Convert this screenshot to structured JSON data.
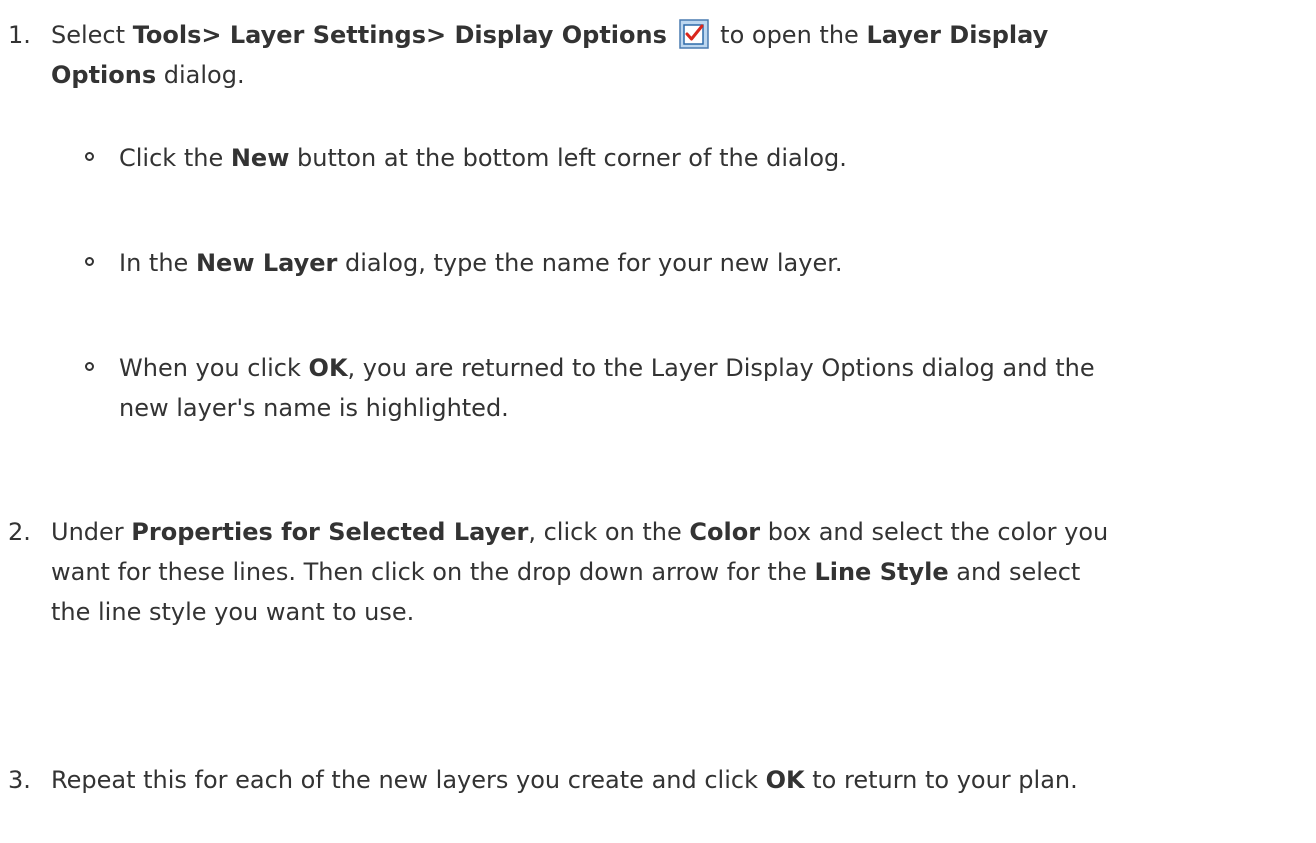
{
  "step1": {
    "number": "1.",
    "select": "Select",
    "menu_path": "Tools> Layer Settings> Display Options",
    "icon": "display-options-checkbox-icon",
    "mid": "to open the",
    "dialog_a": "Layer Display",
    "dialog_b": "Options",
    "end": "dialog."
  },
  "sub1": {
    "pre": "Click the",
    "button": "New",
    "post": "button at the bottom left corner of the dialog."
  },
  "sub2": {
    "pre": "In the",
    "dialog": "New Layer",
    "post": "dialog, type the name for your new layer."
  },
  "sub3": {
    "pre": "When you click",
    "button": "OK",
    "post": ", you are returned to the Layer Display Options dialog and the",
    "line2": "new layer's name is highlighted."
  },
  "step2": {
    "number": "2.",
    "under": "Under",
    "section": "Properties for Selected Layer",
    "a": ", click on the",
    "color": "Color",
    "b": "box and select the color you",
    "c": "want for these lines. Then click on the drop down arrow for the",
    "line_style": "Line Style",
    "d": "and select",
    "e": "the line style you want to use."
  },
  "step3": {
    "number": "3.",
    "pre": "Repeat this for each of the new layers you create and click",
    "button": "OK",
    "post": "to return to your plan."
  }
}
